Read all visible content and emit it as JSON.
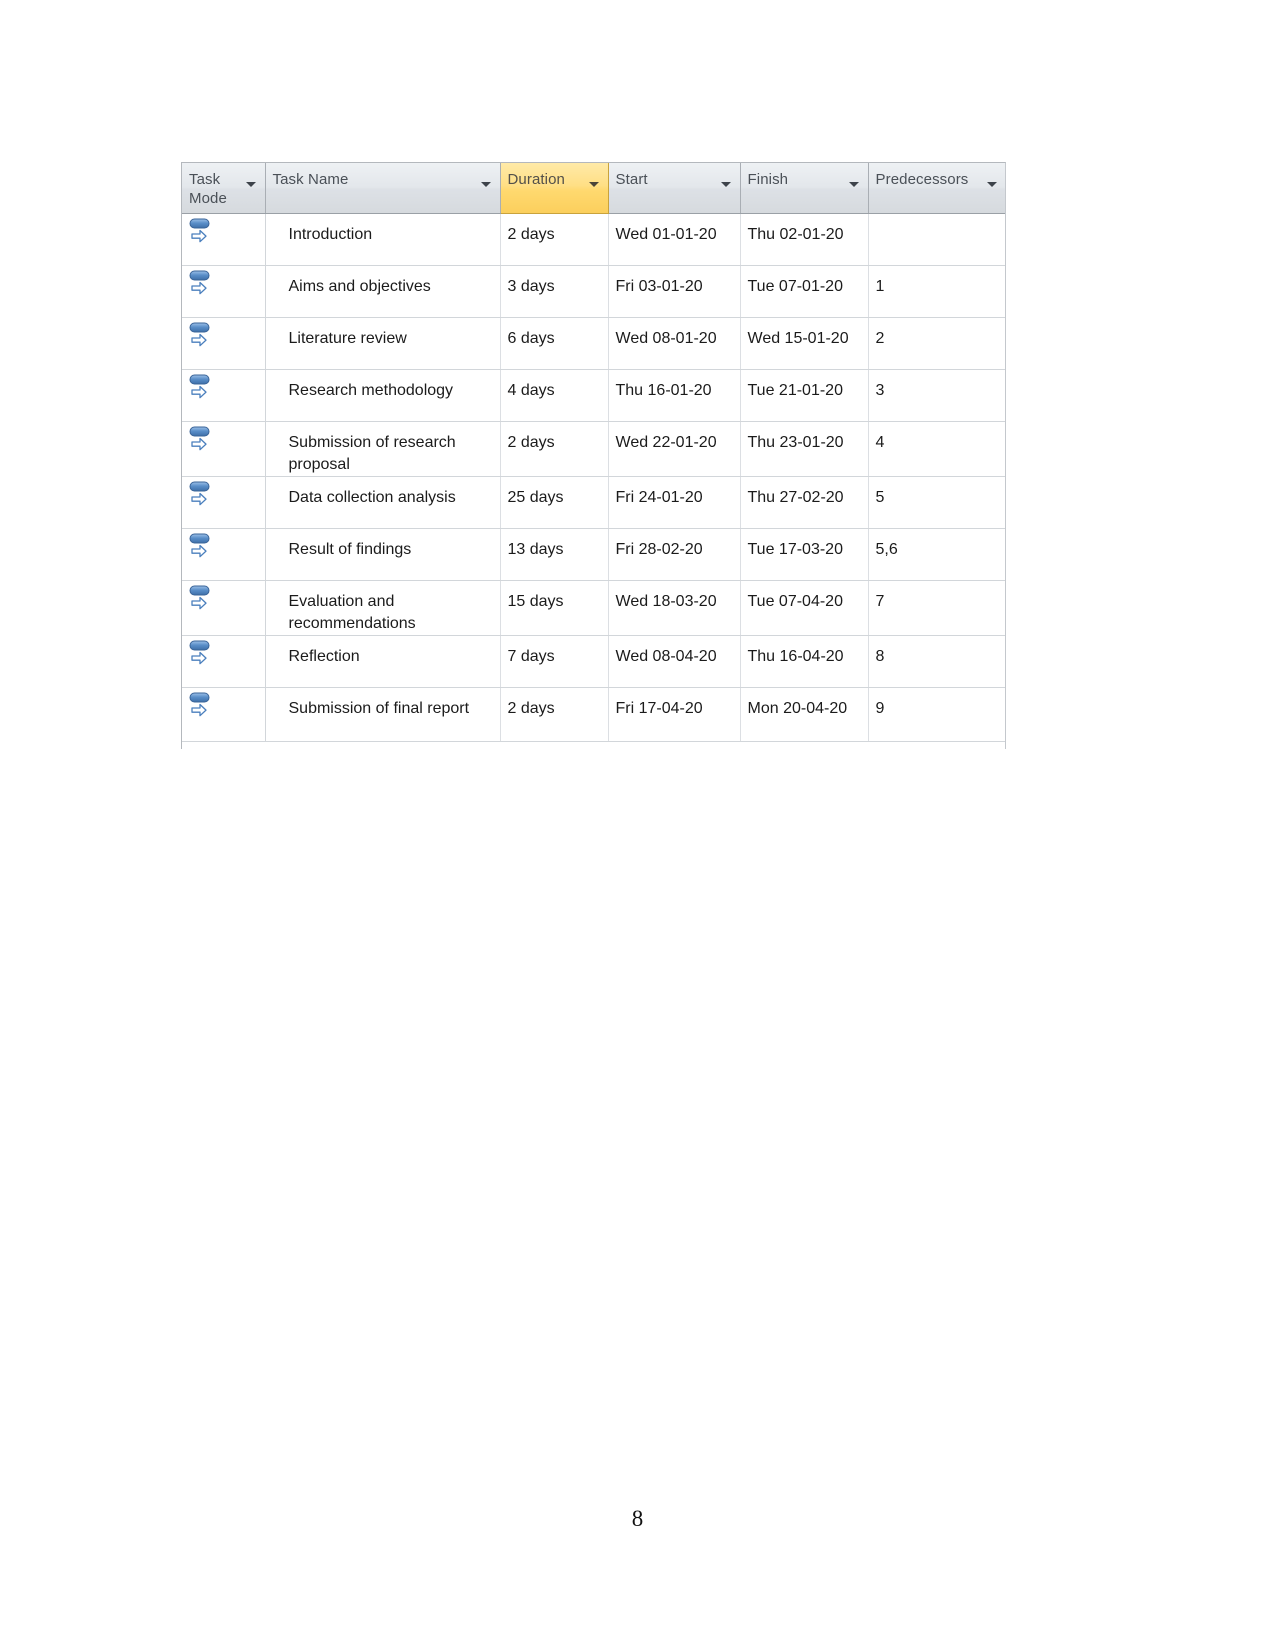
{
  "document": {
    "page_number": "8"
  },
  "table": {
    "name": "project-task-table",
    "accent_highlight_color": "#ffd96f",
    "header_background_color": "#dde1e6",
    "columns": [
      {
        "id": "task_mode",
        "label": "Task\nMode",
        "has_filter_arrow": true,
        "highlighted": false
      },
      {
        "id": "task_name",
        "label": "Task Name",
        "has_filter_arrow": true,
        "highlighted": false
      },
      {
        "id": "duration",
        "label": "Duration",
        "has_filter_arrow": true,
        "highlighted": true
      },
      {
        "id": "start",
        "label": "Start",
        "has_filter_arrow": true,
        "highlighted": false
      },
      {
        "id": "finish",
        "label": "Finish",
        "has_filter_arrow": true,
        "highlighted": false
      },
      {
        "id": "predecessors",
        "label": "Predecessors",
        "has_filter_arrow": true,
        "highlighted": false
      }
    ],
    "rows": [
      {
        "task_mode_icon": "auto-scheduled-icon",
        "task_name": "Introduction",
        "duration": "2 days",
        "start": "Wed 01-01-20",
        "finish": "Thu 02-01-20",
        "predecessors": ""
      },
      {
        "task_mode_icon": "auto-scheduled-icon",
        "task_name": "Aims and objectives",
        "duration": "3 days",
        "start": "Fri 03-01-20",
        "finish": "Tue 07-01-20",
        "predecessors": "1"
      },
      {
        "task_mode_icon": "auto-scheduled-icon",
        "task_name": "Literature review",
        "duration": "6 days",
        "start": "Wed 08-01-20",
        "finish": "Wed 15-01-20",
        "predecessors": "2"
      },
      {
        "task_mode_icon": "auto-scheduled-icon",
        "task_name": "Research methodology",
        "duration": "4 days",
        "start": "Thu 16-01-20",
        "finish": "Tue 21-01-20",
        "predecessors": "3"
      },
      {
        "task_mode_icon": "auto-scheduled-icon",
        "task_name": "Submission of research proposal",
        "duration": "2 days",
        "start": "Wed 22-01-20",
        "finish": "Thu 23-01-20",
        "predecessors": "4"
      },
      {
        "task_mode_icon": "auto-scheduled-icon",
        "task_name": "Data collection analysis",
        "duration": "25 days",
        "start": "Fri 24-01-20",
        "finish": "Thu 27-02-20",
        "predecessors": "5"
      },
      {
        "task_mode_icon": "auto-scheduled-icon",
        "task_name": "Result of findings",
        "duration": "13 days",
        "start": "Fri 28-02-20",
        "finish": "Tue 17-03-20",
        "predecessors": "5,6"
      },
      {
        "task_mode_icon": "auto-scheduled-icon",
        "task_name": "Evaluation and recommendations",
        "duration": "15 days",
        "start": "Wed 18-03-20",
        "finish": "Tue 07-04-20",
        "predecessors": "7"
      },
      {
        "task_mode_icon": "auto-scheduled-icon",
        "task_name": "Reflection",
        "duration": "7 days",
        "start": "Wed 08-04-20",
        "finish": "Thu 16-04-20",
        "predecessors": "8"
      },
      {
        "task_mode_icon": "auto-scheduled-icon",
        "task_name": "Submission of final report",
        "duration": "2 days",
        "start": "Fri 17-04-20",
        "finish": "Mon 20-04-20",
        "predecessors": "9"
      }
    ]
  }
}
